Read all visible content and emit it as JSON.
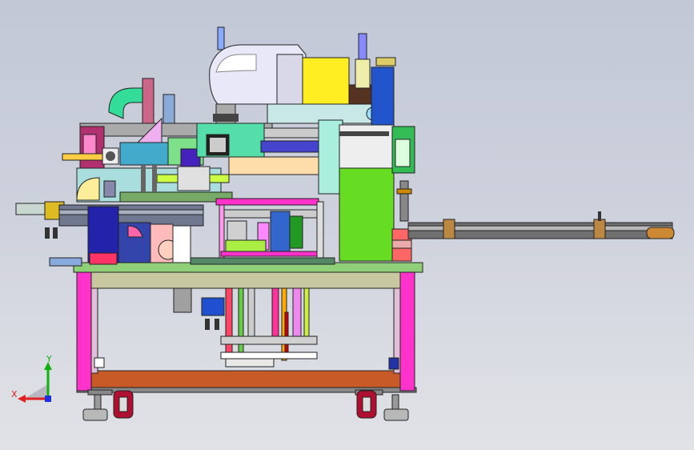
{
  "viewport": {
    "background_top": "#c2c8d6",
    "background_bottom": "#e0e2e6"
  },
  "triad": {
    "x_label": "X",
    "y_label": "Y",
    "x_color": "#e02020",
    "y_color": "#10b010",
    "z_color": "#2030e0"
  },
  "colors": {
    "frame_leg": "#ff33cc",
    "frame_top": "#8fcf78",
    "frame_beam": "#c8c8a0",
    "base_rail": "#c85a28",
    "green_block": "#66dd22",
    "yellow_block": "#ffee22",
    "robot_body": "#e8e8f8",
    "caster": "#b01030"
  }
}
